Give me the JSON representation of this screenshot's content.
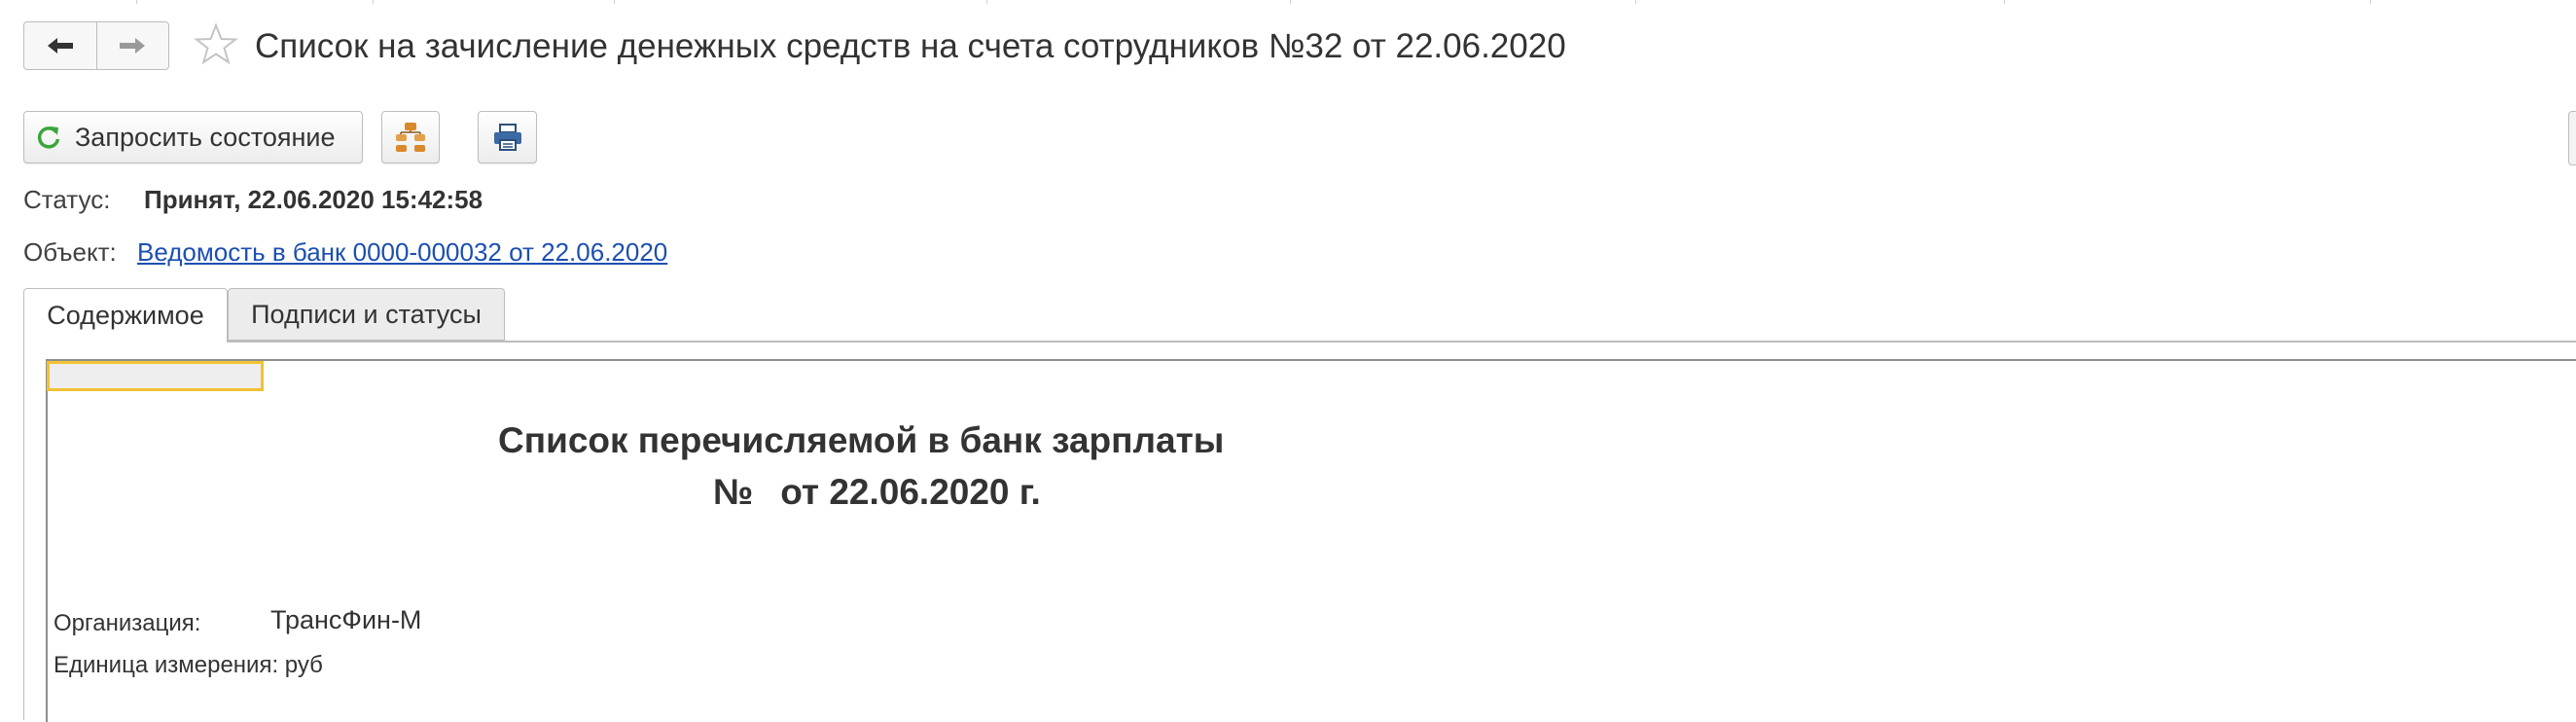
{
  "window": {
    "title": "Список на зачисление денежных средств на счета сотрудников №32 от 22.06.2020"
  },
  "nav": {
    "back_icon": "arrow-left-icon",
    "forward_icon": "arrow-right-icon",
    "favorite_icon": "star-icon"
  },
  "toolbar": {
    "request_status_label": "Запросить состояние",
    "request_status_icon": "refresh-icon",
    "structure_icon": "hierarchy-icon",
    "print_icon": "printer-icon",
    "accent_color": "#3aa63a"
  },
  "info": {
    "status_label": "Статус:",
    "status_value": "Принят, 22.06.2020 15:42:58",
    "object_label": "Объект:",
    "object_link": "Ведомость в банк 0000-000032 от 22.06.2020",
    "link_color": "#1c4fb0"
  },
  "tabs": [
    {
      "label": "Содержимое",
      "active": true
    },
    {
      "label": "Подписи и статусы",
      "active": false
    }
  ],
  "document": {
    "heading": "Список перечисляемой в банк зарплаты",
    "number_label": "№",
    "date_line": "от 22.06.2020 г.",
    "org_label": "Организация:",
    "org_value": "ТрансФин-М",
    "unit_label": "Единица измерения: руб",
    "selection_color": "#f1c232"
  }
}
